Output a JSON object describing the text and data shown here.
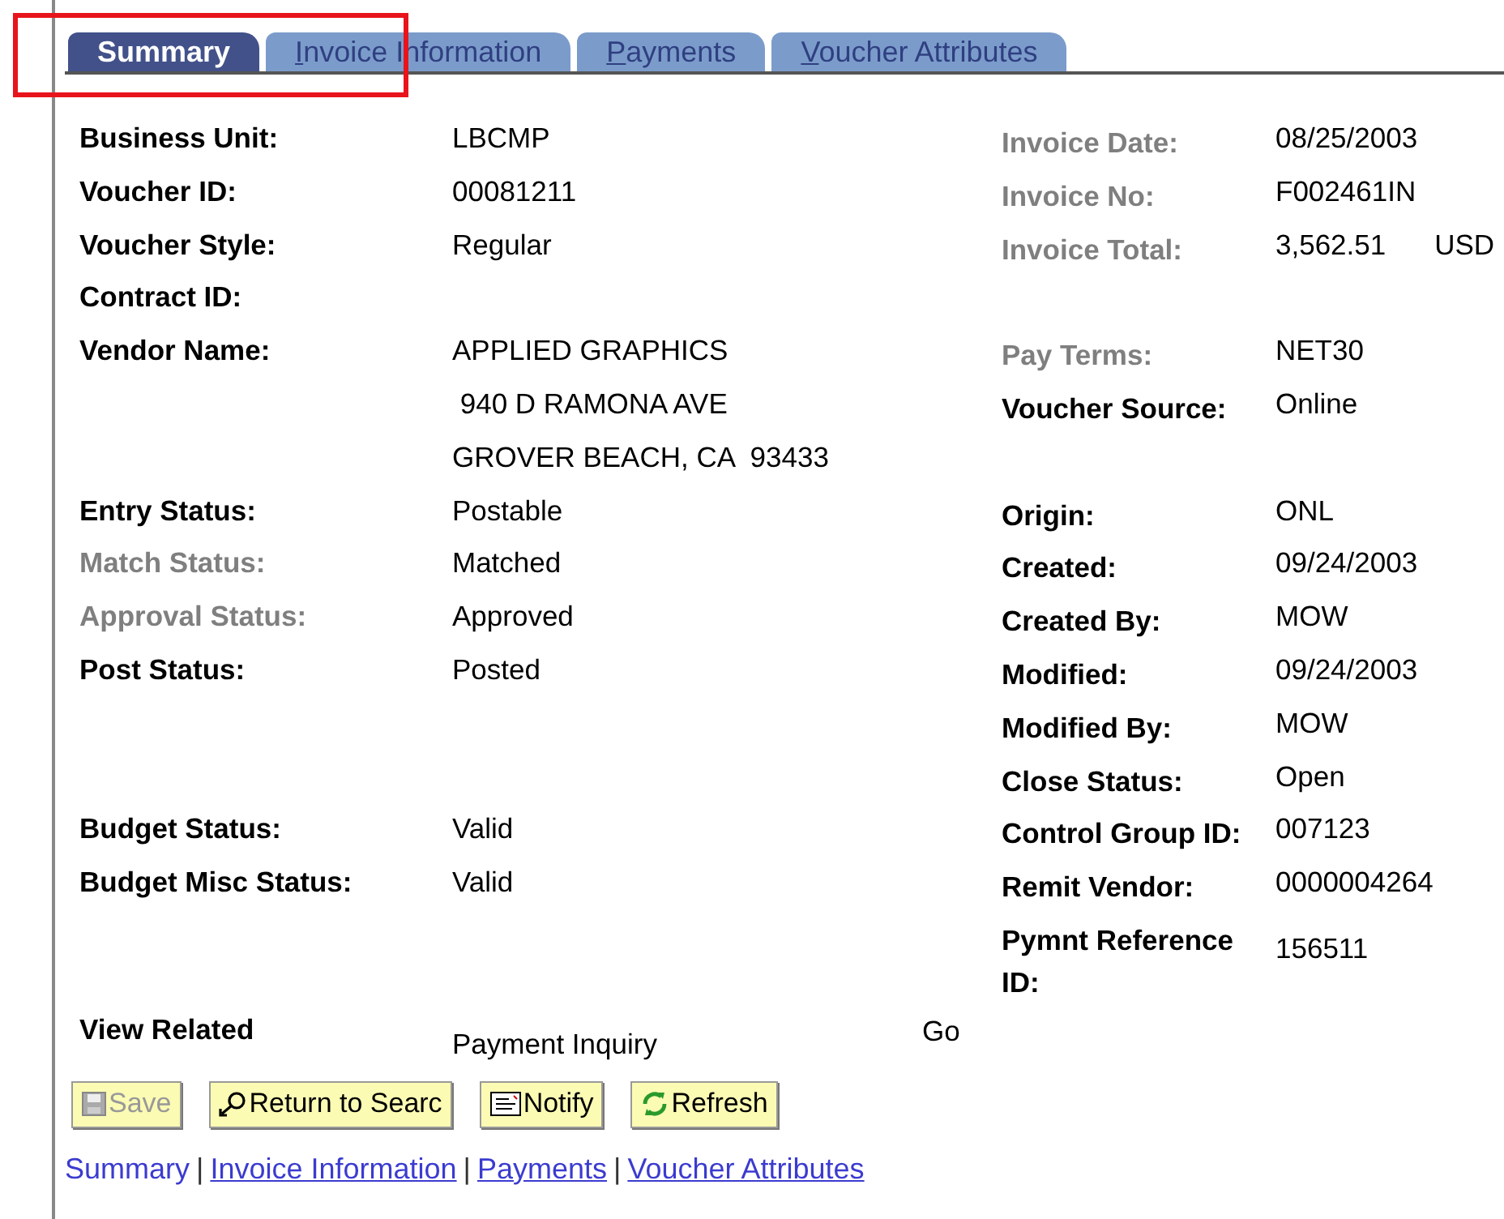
{
  "tabs": [
    {
      "label": "Summary",
      "selected": true,
      "accesskey": false
    },
    {
      "label": "Invoice Information",
      "selected": false,
      "accesskey": true
    },
    {
      "label": "Payments",
      "selected": false,
      "accesskey": true
    },
    {
      "label": "Voucher Attributes",
      "selected": false,
      "accesskey": true
    }
  ],
  "rows": [
    {
      "left": {
        "label": "Business Unit:",
        "dimmed": false,
        "value": "LBCMP"
      },
      "right": {
        "label": "Invoice Date:",
        "dimmed": true,
        "value": "08/25/2003"
      }
    },
    {
      "left": {
        "label": "Voucher ID:",
        "dimmed": false,
        "value": "00081211"
      },
      "right": {
        "label": "Invoice No:",
        "dimmed": true,
        "value": "F002461IN"
      }
    },
    {
      "left": {
        "label": "Voucher Style:",
        "dimmed": false,
        "value": "Regular"
      },
      "right": {
        "label": "Invoice Total:",
        "dimmed": true,
        "value": "3,562.51",
        "currency": "USD"
      }
    },
    {
      "left": {
        "label": "Contract ID:",
        "dimmed": false
      }
    },
    {
      "left": {
        "label": "Vendor Name:",
        "dimmed": false,
        "value": "APPLIED GRAPHICS"
      },
      "right": {
        "label": "Pay Terms:",
        "dimmed": true,
        "value": "NET30"
      }
    },
    {
      "left": {
        "value": " 940 D RAMONA AVE"
      },
      "right": {
        "label": "Voucher Source:",
        "dimmed": false,
        "value": "Online"
      }
    },
    {
      "left": {
        "value": "GROVER BEACH, CA  93433"
      }
    },
    {
      "left": {
        "label": "Entry Status:",
        "dimmed": false,
        "value": "Postable"
      },
      "right": {
        "label": "Origin:",
        "dimmed": false,
        "value": "ONL"
      }
    },
    {
      "left": {
        "label": "Match Status:",
        "dimmed": true,
        "value": "Matched"
      },
      "right": {
        "label": "Created:",
        "dimmed": false,
        "value": "09/24/2003"
      }
    },
    {
      "left": {
        "label": "Approval Status:",
        "dimmed": true,
        "value": "Approved"
      },
      "right": {
        "label": "Created By:",
        "dimmed": false,
        "value": "MOW"
      }
    },
    {
      "left": {
        "label": "Post Status:",
        "dimmed": false,
        "value": "Posted"
      },
      "right": {
        "label": "Modified:",
        "dimmed": false,
        "value": "09/24/2003"
      }
    },
    {
      "right": {
        "label": "Modified By:",
        "dimmed": false,
        "value": "MOW"
      }
    },
    {
      "right": {
        "label": "Close Status:",
        "dimmed": false,
        "value": "Open"
      }
    },
    {
      "left": {
        "label": "Budget Status:",
        "dimmed": false,
        "value": "Valid"
      },
      "right": {
        "label": "Control Group ID:",
        "dimmed": false,
        "value": "007123"
      }
    },
    {
      "left": {
        "label": "Budget Misc Status:",
        "dimmed": false,
        "value": "Valid"
      },
      "right": {
        "label": "Remit Vendor:",
        "dimmed": false,
        "value": "0000004264"
      }
    },
    {
      "right": {
        "label": "Pymnt Reference ID:",
        "dimmed": false,
        "value": "156511"
      }
    }
  ],
  "view_related": {
    "label": "View Related",
    "value": "Payment Inquiry",
    "button": "Go"
  },
  "buttons": [
    {
      "label": "Save",
      "kind": "save",
      "disabled": true
    },
    {
      "label": "Return to Searc",
      "kind": "search",
      "disabled": false
    },
    {
      "label": "Notify",
      "kind": "notify",
      "disabled": false
    },
    {
      "label": "Refresh",
      "kind": "refresh",
      "disabled": false
    }
  ],
  "bottom_links": {
    "separator": "|",
    "items": [
      {
        "label": "Summary",
        "selected": true
      },
      {
        "label": "Invoice Information",
        "selected": false
      },
      {
        "label": "Payments",
        "selected": false
      },
      {
        "label": "Voucher Attributes",
        "selected": false
      }
    ]
  }
}
